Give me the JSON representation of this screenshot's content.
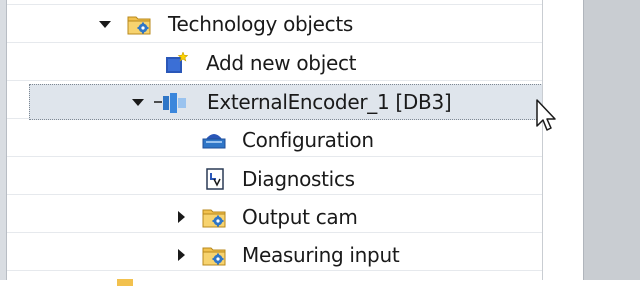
{
  "tree": {
    "items": [
      {
        "label": "Technology objects",
        "icon": "folder-gear-icon",
        "expander": "expanded"
      },
      {
        "label": "Add new object",
        "icon": "add-object-icon"
      },
      {
        "label": "ExternalEncoder_1 [DB3]",
        "icon": "encoder-icon",
        "expander": "expanded",
        "selected": true
      },
      {
        "label": "Configuration",
        "icon": "configuration-icon"
      },
      {
        "label": "Diagnostics",
        "icon": "diagnostics-icon"
      },
      {
        "label": "Output cam",
        "icon": "folder-gear-icon",
        "expander": "collapsed"
      },
      {
        "label": "Measuring input",
        "icon": "folder-gear-icon",
        "expander": "collapsed"
      }
    ]
  },
  "colors": {
    "selection_bg": "#dfe5ec",
    "folder": "#f2c14e",
    "gear": "#2f76c7",
    "text": "#1a1a1a"
  }
}
